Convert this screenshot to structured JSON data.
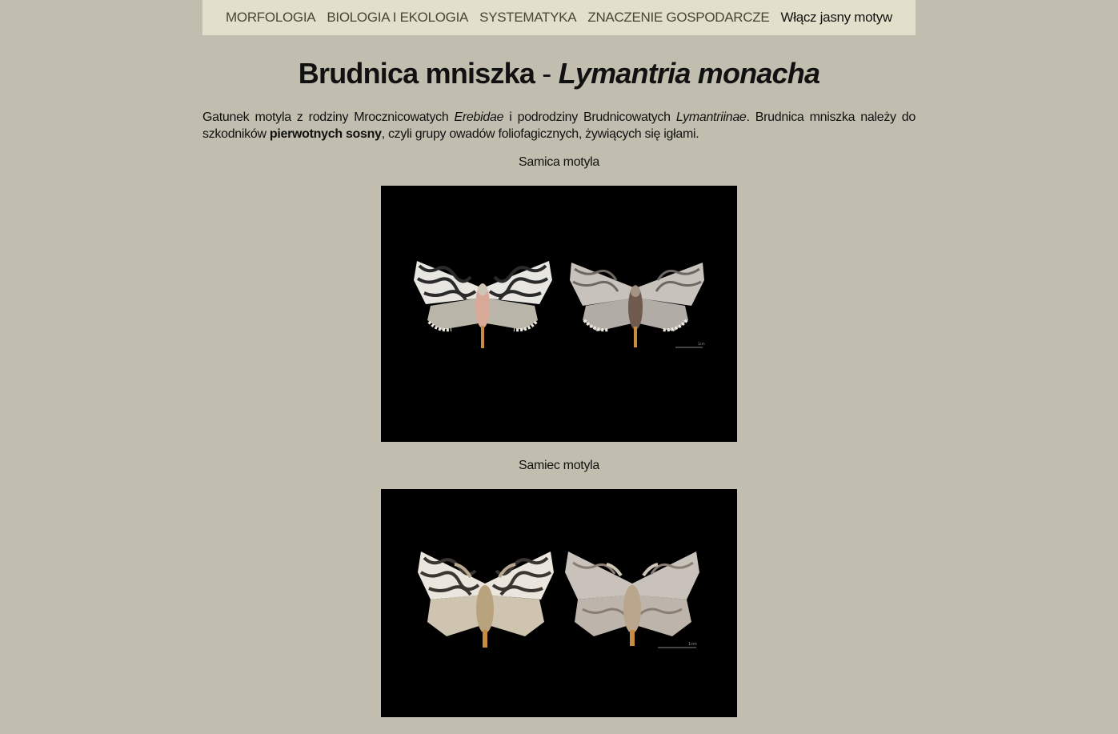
{
  "nav": {
    "items": [
      "MORFOLOGIA",
      "BIOLOGIA I EKOLOGIA",
      "SYSTEMATYKA",
      "ZNACZENIE GOSPODARCZE"
    ],
    "theme_toggle": "Włącz jasny motyw"
  },
  "title": {
    "common": "Brudnica mniszka",
    "separator": "-",
    "latin": "Lymantria monacha"
  },
  "intro": {
    "t1": "Gatunek motyla z rodziny Mrocznicowatych ",
    "family_latin": "Erebidae",
    "t2": " i podrodziny Brudnicowatych ",
    "subfamily_latin": "Lymantriinae",
    "t3": ". Brudnica mniszka należy do szkodników ",
    "bold": "pierwotnych sosny",
    "t4": ", czyli grupy owadów foliofagicznych, żywiących się igłami."
  },
  "figures": {
    "female_caption": "Samica motyla",
    "male_caption": "Samiec motyla",
    "female_scale_label": "1cm",
    "male_scale_label": "1cm"
  },
  "colors": {
    "background": "#c1beaf",
    "nav_background": "#e2e0cb",
    "nav_text": "#4b4536",
    "photo_background": "#000000"
  }
}
